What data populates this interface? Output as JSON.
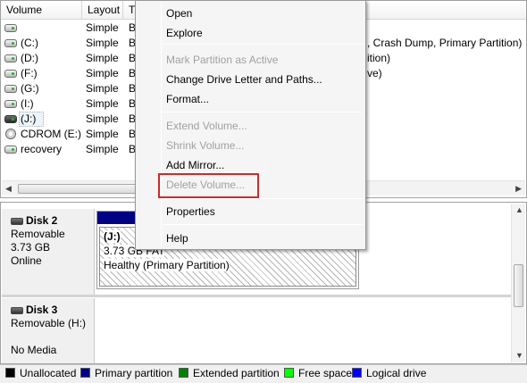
{
  "volume_list": {
    "columns": [
      "Volume",
      "Layout",
      "T"
    ],
    "rows": [
      {
        "volume": "",
        "layout": "Simple",
        "type": "B",
        "icon": "drive-icon"
      },
      {
        "volume": "(C:)",
        "layout": "Simple",
        "type": "B",
        "icon": "drive-icon"
      },
      {
        "volume": "(D:)",
        "layout": "Simple",
        "type": "B",
        "icon": "drive-icon"
      },
      {
        "volume": "(F:)",
        "layout": "Simple",
        "type": "B",
        "icon": "drive-icon"
      },
      {
        "volume": "(G:)",
        "layout": "Simple",
        "type": "B",
        "icon": "drive-icon"
      },
      {
        "volume": "(I:)",
        "layout": "Simple",
        "type": "B",
        "icon": "drive-icon"
      },
      {
        "volume": "(J:)",
        "layout": "Simple",
        "type": "B",
        "icon": "removable-drive-icon"
      },
      {
        "volume": "CDROM (E:)",
        "layout": "Simple",
        "type": "B",
        "icon": "cdrom-icon"
      },
      {
        "volume": "recovery",
        "layout": "Simple",
        "type": "B",
        "icon": "drive-icon"
      }
    ],
    "status_fragments": [
      ", Crash Dump, Primary Partition)",
      "ition)",
      "ve)"
    ]
  },
  "disks": [
    {
      "name": "Disk 2",
      "kind": "Removable",
      "size": "3.73 GB",
      "state": "Online",
      "partition": {
        "label": "(J:)",
        "size_fs": "3.73 GB FAT",
        "status": "Healthy (Primary Partition)"
      }
    },
    {
      "name": "Disk 3",
      "kind": "Removable (H:)",
      "state": "No Media"
    }
  ],
  "context_menu": {
    "items": [
      {
        "label": "Open",
        "disabled": false
      },
      {
        "label": "Explore",
        "disabled": false
      },
      {
        "label": "Mark Partition as Active",
        "disabled": true
      },
      {
        "label": "Change Drive Letter and Paths...",
        "disabled": false
      },
      {
        "label": "Format...",
        "disabled": false
      },
      {
        "label": "Extend Volume...",
        "disabled": true
      },
      {
        "label": "Shrink Volume...",
        "disabled": true
      },
      {
        "label": "Add Mirror...",
        "disabled": false
      },
      {
        "label": "Delete Volume...",
        "disabled": true
      },
      {
        "label": "Properties",
        "disabled": false
      },
      {
        "label": "Help",
        "disabled": false
      }
    ],
    "highlight_color": "#d02a2a"
  },
  "legend": [
    {
      "label": "Unallocated",
      "color": "#000000"
    },
    {
      "label": "Primary partition",
      "color": "#000084"
    },
    {
      "label": "Extended partition",
      "color": "#008000"
    },
    {
      "label": "Free space",
      "color": "#00ff00"
    },
    {
      "label": "Logical drive",
      "color": "#0000ff"
    }
  ]
}
